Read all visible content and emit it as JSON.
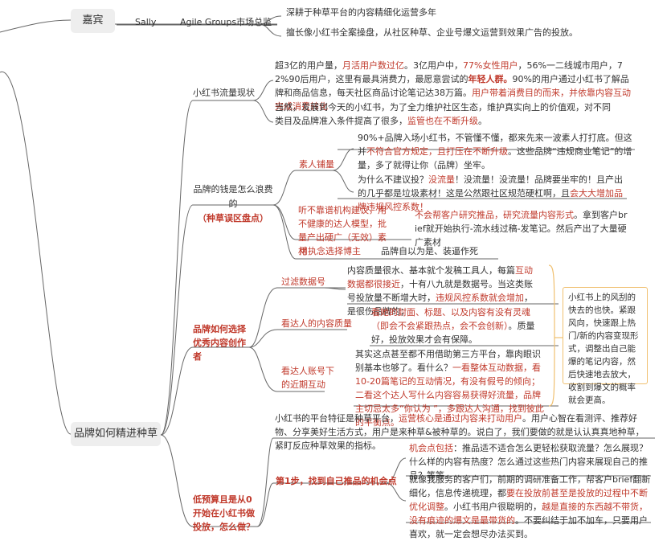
{
  "root1": "嘉宾",
  "root2": "品牌如何精进种草",
  "guest": {
    "name": "Sally",
    "title": "Agile Groups市场总监",
    "desc1": "深耕于种草平台的内容精细化运营多年",
    "desc2": "擅长像小红书全案操盘，从社区种草、企业号爆文运营到效果广告的投放。"
  },
  "sec1": {
    "label": "小红书流量现状",
    "p1": [
      {
        "t": "超3亿的用户量，",
        "s": ""
      },
      {
        "t": "月活用户数过亿",
        "s": "r"
      },
      {
        "t": "。3亿用户中，",
        "s": ""
      },
      {
        "t": "77%女性用户",
        "s": "r"
      },
      {
        "t": "，56%一二线城市用户，72%90后用户，这里有最具消费力，最愿意尝试的",
        "s": ""
      },
      {
        "t": "年轻人群。",
        "s": "rb"
      },
      {
        "t": "90%的用户通过小红书了解品牌和商品信息，每天社区商品讨论笔记达38万篇。",
        "s": ""
      },
      {
        "t": "用户带着消费目的而来，并依靠内容互动完成消费转化",
        "s": "r"
      }
    ],
    "p2": [
      {
        "t": "当然，发展到今天的小红书，为了全力维护社区生态，维护真实向上的价值观，对不同类目及品牌准入条件提高了很多，",
        "s": ""
      },
      {
        "t": "监管也在不断升级",
        "s": "r"
      },
      {
        "t": "。",
        "s": ""
      }
    ]
  },
  "sec2": {
    "label1": "品牌的钱是怎么浪费的",
    "label2": "（种草误区盘点）",
    "sub1": "素人铺量",
    "sub1_p1": [
      {
        "t": "90%+品牌入场小红书，不管懂不懂，都来先来一波素人打打底。但这并",
        "s": ""
      },
      {
        "t": "不符合官方规定，且打压在不断升级",
        "s": "r"
      },
      {
        "t": "。这些品牌“违规商业笔记”的增量，多了就得让你（品牌）坐牢。",
        "s": ""
      }
    ],
    "sub1_p2": [
      {
        "t": "为什么不建议投？",
        "s": ""
      },
      {
        "t": "没流量",
        "s": "r"
      },
      {
        "t": "！没流量！没流量！品牌要坐牢的！且产出的几乎都是垃圾素材！这是公然跟社区规范硬杠啊，且",
        "s": ""
      },
      {
        "t": "会大大增加品牌违规风控系数！",
        "s": "r"
      }
    ],
    "sub2": "听不靠谱机构建议，用不健康的达人模型，批量产出硬广（无效）素材",
    "sub2_p": [
      {
        "t": "不会帮客户研究推品，研究流量内容形式",
        "s": "r"
      },
      {
        "t": "。拿到客户brief就开始执行-流水线过稿-发笔记。然后产出了大量硬广素材",
        "s": ""
      }
    ],
    "sub3": "用执念选择博主",
    "sub3_p": "品牌自以为是、装逼作死"
  },
  "sec3": {
    "label": "品牌如何选择优秀内容创作者",
    "sub1": "过滤数据号",
    "sub1_p": [
      {
        "t": "内容质量很水、基本就个发稿工具人，每篇",
        "s": ""
      },
      {
        "t": "互动数据都很接近",
        "s": "r"
      },
      {
        "t": "，十有八九就是数据号。当这类账号投放量不断增大时，",
        "s": ""
      },
      {
        "t": "违规风控系数就会增加",
        "s": "r"
      },
      {
        "t": "，是很伤品牌的；",
        "s": ""
      }
    ],
    "sub2": "看达人的内容质量",
    "sub2_p": [
      {
        "t": "看她的封面、标题、以及内容有没有灵魂（即会不会紧跟热点，会不会创新）",
        "s": "r"
      },
      {
        "t": "。质量好，投放效果才会有保障。",
        "s": ""
      }
    ],
    "sub3": "看达人账号下的近期互动",
    "sub3_p": [
      {
        "t": "其实这点甚至都不用借助第三方平台，靠肉眼识别基本也够了。看什么？",
        "s": ""
      },
      {
        "t": "一看整体互动数据，看10-20篇笔记的互动情况，有没有假号的倾向；二看这个达人写什么内容容易获得好流量，品牌主切忌太多“你认为 ”，多跟达人沟通，找到彼此的平衡点。",
        "s": "r"
      }
    ],
    "note": "小红书上的风刮的快去的也快。紧跟风向，快速跟上热门/新的内容变现形式，调整出自己能爆的笔记内容，然后快速地去放大，收割到爆文的概率就会更高。"
  },
  "sec4": {
    "intro": [
      {
        "t": "小红书的平台特征是种草平台，",
        "s": ""
      },
      {
        "t": "运营核心是通过内容来打动用户",
        "s": "r"
      },
      {
        "t": "。用户心智在看测评、推荐好物、分享美好生活方式，用户是来种草&被种草的。说白了，我们要做的就是认认真真地种草，紧盯反应种草效果的指标。",
        "s": ""
      }
    ],
    "label": "低预算且是从0开始在小红书做投放，怎么做？",
    "step1": "第1步，找到自己推品的机会点",
    "step1_p1": [
      {
        "t": "机会点包括",
        "s": "r"
      },
      {
        "t": "：推品适不适合怎么更轻松获取流量？怎么展现？什么样的内容有热度？怎么通过这些热门内容来展现自己的推品？等等。",
        "s": ""
      }
    ],
    "step1_p2": [
      {
        "t": "就像我服务的客户们，前期的调研准备工作，帮客户brief翻新细化，信息传递梳理，都",
        "s": ""
      },
      {
        "t": "要在投放前甚至是投放的过程中不断优化调整",
        "s": "r"
      },
      {
        "t": "。小红书用户很聪明的，",
        "s": ""
      },
      {
        "t": "越是直接的东西越不带货，没有痕迹的爆文是最带货的",
        "s": "r"
      },
      {
        "t": "。不要纠结于加不加车，只要用户喜欢，就一定会想尽办法买到。",
        "s": ""
      }
    ]
  },
  "colors": {
    "red": "#c0392b",
    "line": "#666666",
    "yellow": "#f0c070"
  }
}
